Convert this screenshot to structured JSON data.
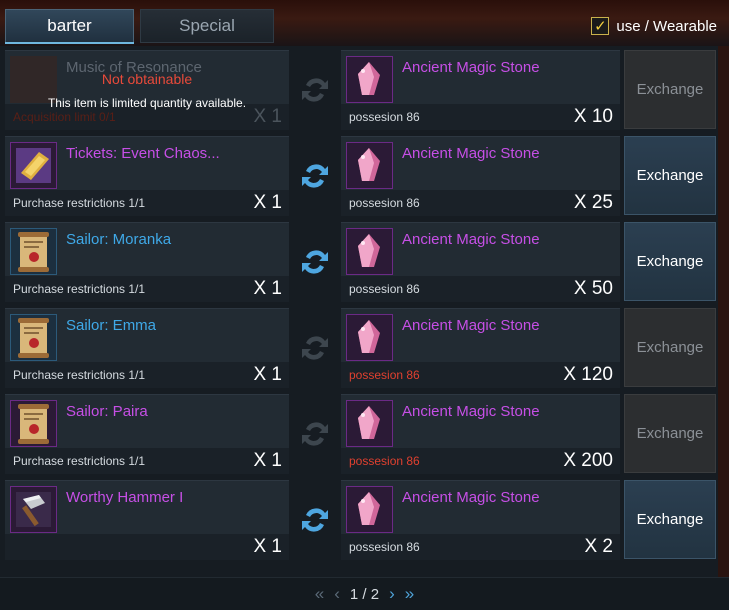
{
  "tabs": {
    "barter": "barter",
    "special": "Special"
  },
  "wearable": {
    "checkmark": "✓",
    "label": "use / Wearable"
  },
  "rows": [
    {
      "left": {
        "name": "Music of Resonance",
        "overlay_title": "Not obtainable",
        "overlay_text": "This item is limited quantity available.",
        "sub": "Acquisition limit 0/1",
        "qty": "X 1"
      },
      "right": {
        "name": "Ancient Magic Stone",
        "sub": "possesion 86",
        "qty": "X 10"
      },
      "button": "Exchange"
    },
    {
      "left": {
        "name": "Tickets: Event Chaos...",
        "sub": "Purchase restrictions 1/1",
        "qty": "X 1"
      },
      "right": {
        "name": "Ancient Magic Stone",
        "sub": "possesion 86",
        "qty": "X 25"
      },
      "button": "Exchange"
    },
    {
      "left": {
        "name": "Sailor: Moranka",
        "sub": "Purchase restrictions 1/1",
        "qty": "X 1"
      },
      "right": {
        "name": "Ancient Magic Stone",
        "sub": "possesion 86",
        "qty": "X 50"
      },
      "button": "Exchange"
    },
    {
      "left": {
        "name": "Sailor: Emma",
        "sub": "Purchase restrictions 1/1",
        "qty": "X 1"
      },
      "right": {
        "name": "Ancient Magic Stone",
        "sub": "possesion 86",
        "qty": "X 120"
      },
      "button": "Exchange"
    },
    {
      "left": {
        "name": "Sailor: Paira",
        "sub": "Purchase restrictions 1/1",
        "qty": "X 1"
      },
      "right": {
        "name": "Ancient Magic Stone",
        "sub": "possesion 86",
        "qty": "X 200"
      },
      "button": "Exchange"
    },
    {
      "left": {
        "name": "Worthy Hammer I",
        "qty": "X 1"
      },
      "right": {
        "name": "Ancient Magic Stone",
        "sub": "possesion 86",
        "qty": "X 2"
      },
      "button": "Exchange"
    }
  ],
  "pager": {
    "first": "«",
    "prev": "‹",
    "page": "1 / 2",
    "next": "›",
    "last": "»"
  },
  "colors": {
    "purple_name": "#c64fe6",
    "blue_name": "#3fa9e8",
    "red_text": "#e0402f",
    "exchange_active": "#223341",
    "exchange_disabled": "#2c2e30"
  }
}
